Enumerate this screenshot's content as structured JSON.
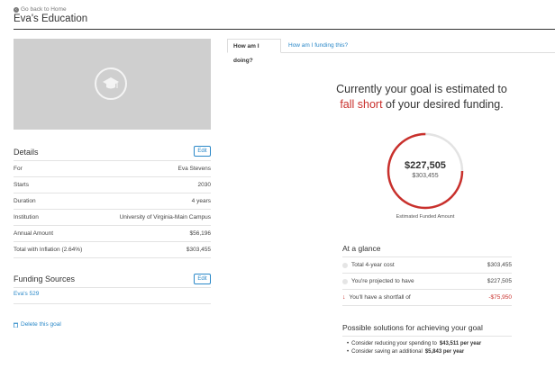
{
  "header": {
    "back_label": "Go back to Home",
    "title": "Eva's Education"
  },
  "hero": {
    "icon": "graduation-cap-icon"
  },
  "details": {
    "title": "Details",
    "edit_label": "Edit",
    "rows": [
      {
        "label": "For",
        "value": "Eva Stevens"
      },
      {
        "label": "Starts",
        "value": "2030"
      },
      {
        "label": "Duration",
        "value": "4 years"
      },
      {
        "label": "Institution",
        "value": "University of Virginia-Main Campus"
      },
      {
        "label": "Annual Amount",
        "value": "$56,196"
      },
      {
        "label": "Total with Inflation (2.64%)",
        "value": "$303,455"
      }
    ]
  },
  "funding": {
    "title": "Funding Sources",
    "edit_label": "Edit",
    "sources": [
      "Eva's 529"
    ]
  },
  "delete_label": "Delete this goal",
  "tabs": [
    {
      "label": "How am I doing?",
      "active": true
    },
    {
      "label": "How am I funding this?",
      "active": false
    }
  ],
  "status": {
    "line1": "Currently your goal is estimated to",
    "highlight": "fall short",
    "line2_rest": " of your desired funding."
  },
  "gauge": {
    "funded_amount": "$227,505",
    "goal_amount": "$303,455",
    "caption": "Estimated Funded Amount",
    "funded_fraction": 0.75,
    "colors": {
      "funded": "#c9302c",
      "remaining": "#e3e3e3"
    }
  },
  "glance": {
    "title": "At a glance",
    "rows": [
      {
        "label": "Total 4-year cost",
        "value": "$303,455",
        "marker": "dot"
      },
      {
        "label": "You're projected to have",
        "value": "$227,505",
        "marker": "dot"
      },
      {
        "label": "You'll have a shortfall of",
        "value": "-$75,950",
        "marker": "down-arrow"
      }
    ]
  },
  "solutions": {
    "title": "Possible solutions for achieving your goal",
    "items": [
      {
        "prefix": "Consider reducing your spending to",
        "emphasis": "$43,511 per year"
      },
      {
        "prefix": "Consider saving an additional",
        "emphasis": "$5,843 per year"
      }
    ]
  },
  "colors": {
    "link": "#2a88c8",
    "danger": "#c9302c"
  }
}
